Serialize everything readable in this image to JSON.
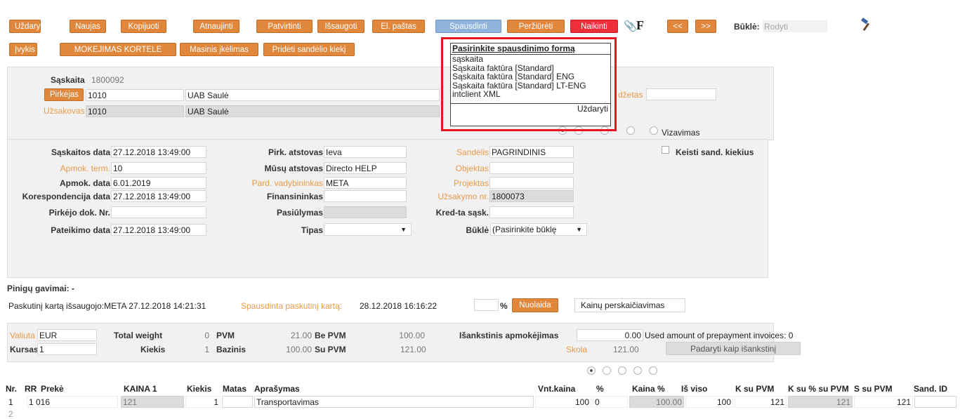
{
  "toolbar": {
    "row1": [
      "Uždaryti",
      "Naujas",
      "Kopijuoti",
      "Atnaujinti",
      "Patvirtinti",
      "Išsaugoti",
      "El. paštas",
      "Spausdinti",
      "Peržiūrėti",
      "Naikinti"
    ],
    "prev": "<<",
    "next": ">>",
    "status_label": "Būklė:",
    "status_value": "Rodyti",
    "f_label": "F",
    "row2": [
      "Įvykis",
      "MOKEJIMAS KORTELE",
      "Masinis įkėlimas",
      "Pridėti sandėlio kiekį"
    ]
  },
  "print_menu": {
    "title": "Pasirinkite spausdinimo formą",
    "items": [
      "sąskaita",
      "Sąskaita faktūra [Standard]",
      "Sąskaita faktūra [Standard] ENG",
      "Sąskaita faktūra [Standard] LT-ENG",
      "intclient XML"
    ],
    "close": "Uždaryti"
  },
  "header": {
    "invoice_label": "Sąskaita",
    "invoice_value": "1800092",
    "buyer_btn": "Pirkėjas",
    "buyer_code": "1010",
    "buyer_name": "UAB Saulė",
    "orderer_label": "Užsakovas",
    "orderer_code": "1010",
    "orderer_name": "UAB Saulė",
    "budget_label": "džetas",
    "vizavimas": "Vizavimas"
  },
  "details": {
    "invoice_date_label": "Sąskaitos data",
    "invoice_date": "27.12.2018 13:49:00",
    "payment_term_label": "Apmok. term.",
    "payment_term": "10",
    "payment_date_label": "Apmok. data",
    "payment_date": "6.01.2019",
    "corr_date_label": "Korespondencija data",
    "corr_date": "27.12.2018 13:49:00",
    "buyer_doc_label": "Pirkėjo dok. Nr.",
    "buyer_doc": "",
    "delivery_date_label": "Pateikimo data",
    "delivery_date": "27.12.2018 13:49:00",
    "buyer_rep_label": "Pirk. atstovas",
    "buyer_rep": "Ieva",
    "our_rep_label": "Mūsų atstovas",
    "our_rep": "Directo HELP",
    "sales_mgr_label": "Pard. vadybininkas",
    "sales_mgr": "META",
    "financier_label": "Finansininkas",
    "financier": "",
    "offer_label": "Pasiūlymas",
    "offer": "",
    "type_label": "Tipas",
    "type": "",
    "warehouse_label": "Sandėlis",
    "warehouse": "PAGRINDINIS",
    "object_label": "Objektas",
    "object": "",
    "project_label": "Projektas",
    "project": "",
    "order_no_label": "Užsakymo nr.",
    "order_no": "1800073",
    "credit_label": "Kred-ta sąsk.",
    "credit": "",
    "state_label": "Būklė",
    "state": "(Pasirinkite būklę",
    "change_qty_label": "Keisti sand. kiekius"
  },
  "payments": {
    "label": "Pinigų gavimai: -",
    "last_saved": "Paskutinį kartą išsaugojo:META 27.12.2018 14:21:31",
    "last_printed_label": "Spausdinta paskutinį kartą:",
    "last_printed": "28.12.2018 16:16:22",
    "percent": "%",
    "discount_btn": "Nuolaida",
    "recalc_btn": "Kainų perskaičiavimas"
  },
  "totals": {
    "currency_label": "Valiuta",
    "currency": "EUR",
    "rate_label": "Kursas",
    "rate": "1",
    "weight_label": "Total weight",
    "weight": "0",
    "qty_label": "Kiekis",
    "qty": "1",
    "vat_label": "PVM",
    "vat": "21.00",
    "base_label": "Bazinis",
    "base": "100.00",
    "excl_label": "Be PVM",
    "excl": "100.00",
    "incl_label": "Su PVM",
    "incl": "121.00",
    "prepay_label": "Išankstinis apmokėjimas",
    "prepay": "0.00",
    "prepay_used": "Used amount of prepayment invoices: 0",
    "debt_label": "Skola",
    "debt": "121.00",
    "make_prepay_btn": "Padaryti kaip išankstinį"
  },
  "table": {
    "headers": [
      "Nr.",
      "RR",
      "Prekė",
      "KAINA 1",
      "Kiekis",
      "Matas",
      "Aprašymas",
      "Vnt.kaina",
      "%",
      "Kaina %",
      "Iš viso",
      "K su PVM",
      "K su % su PVM",
      "S su PVM",
      "Sand. ID"
    ],
    "row": {
      "nr": "1",
      "item": "1 016",
      "price1": "121",
      "qty": "1",
      "unit": "",
      "desc": "Transportavimas",
      "unit_price": "100",
      "pct": "0",
      "price_pct": "100.00",
      "total": "100",
      "k_vat": "121",
      "k_pct_vat": "121",
      "s_vat": "121"
    },
    "row2_nr": "2"
  },
  "colors": {
    "orange": "#e0873c",
    "blue": "#8fb3dc",
    "red": "#ee2f3a",
    "highlight": "#e5161e"
  }
}
